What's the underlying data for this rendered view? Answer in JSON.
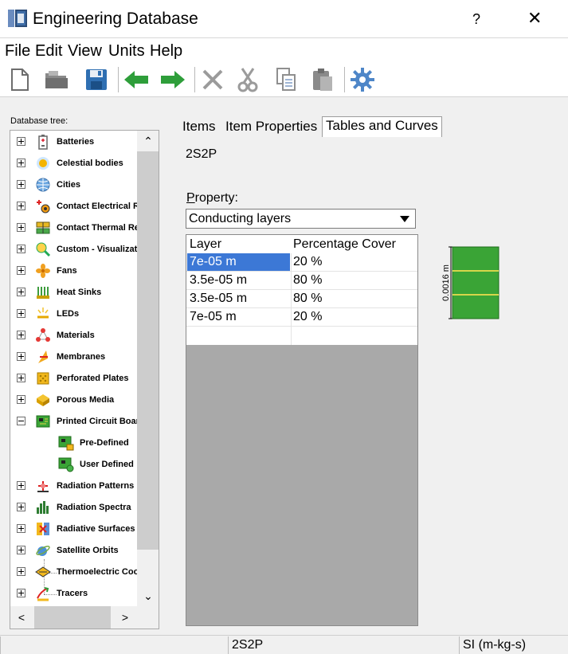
{
  "window": {
    "title": "Engineering Database",
    "help_glyph": "?",
    "close_glyph": "✕"
  },
  "menu": [
    "File",
    "Edit",
    "View",
    "Units",
    "Help"
  ],
  "toolbar": {
    "icons": [
      "new-file-icon",
      "open-folder-icon",
      "save-icon",
      "back-arrow-icon",
      "forward-arrow-icon",
      "delete-icon",
      "cut-icon",
      "copy-icon",
      "paste-icon",
      "settings-gear-icon"
    ]
  },
  "tree": {
    "label": "Database tree:",
    "items": [
      {
        "label": "Batteries",
        "icon": "battery-icon"
      },
      {
        "label": "Celestial bodies",
        "icon": "sun-icon"
      },
      {
        "label": "Cities",
        "icon": "globe-icon"
      },
      {
        "label": "Contact Electrical R",
        "icon": "contact-electrical-icon"
      },
      {
        "label": "Contact Thermal Re",
        "icon": "contact-thermal-icon"
      },
      {
        "label": "Custom - Visualizati",
        "icon": "magnifier-icon"
      },
      {
        "label": "Fans",
        "icon": "fan-icon"
      },
      {
        "label": "Heat Sinks",
        "icon": "heat-sink-icon"
      },
      {
        "label": "LEDs",
        "icon": "led-icon"
      },
      {
        "label": "Materials",
        "icon": "materials-icon"
      },
      {
        "label": "Membranes",
        "icon": "membrane-icon"
      },
      {
        "label": "Perforated Plates",
        "icon": "perforated-plate-icon"
      },
      {
        "label": "Porous Media",
        "icon": "porous-media-icon"
      },
      {
        "label": "Printed Circuit Boar",
        "icon": "pcb-icon",
        "expanded": true
      },
      {
        "label": "Radiation Patterns",
        "icon": "radiation-pattern-icon"
      },
      {
        "label": "Radiation Spectra",
        "icon": "radiation-spectra-icon"
      },
      {
        "label": "Radiative Surfaces",
        "icon": "radiative-surface-icon"
      },
      {
        "label": "Satellite Orbits",
        "icon": "satellite-icon"
      },
      {
        "label": "Thermoelectric Coo",
        "icon": "thermoelectric-icon"
      },
      {
        "label": "Tracers",
        "icon": "tracer-icon"
      }
    ],
    "children": [
      {
        "label": "Pre-Defined",
        "icon": "pcb-locked-icon"
      },
      {
        "label": "User Defined",
        "icon": "pcb-user-icon"
      }
    ],
    "scroll_up": "⌃",
    "scroll_down": "⌄",
    "scroll_left": "<",
    "scroll_right": ">"
  },
  "tabs": [
    {
      "label": "Items",
      "active": false
    },
    {
      "label": "Item Properties",
      "active": false
    },
    {
      "label": "Tables and Curves",
      "active": true
    }
  ],
  "item_name": "2S2P",
  "property": {
    "label_prefix": "P",
    "label_rest": "roperty:",
    "selected": "Conducting layers"
  },
  "table": {
    "headers": [
      "Layer",
      "Percentage Cover"
    ],
    "rows": [
      {
        "layer": "7e-05 m",
        "cover": "20 %"
      },
      {
        "layer": "3.5e-05 m",
        "cover": "80 %"
      },
      {
        "layer": "3.5e-05 m",
        "cover": "80 %"
      },
      {
        "layer": "7e-05 m",
        "cover": "20 %"
      }
    ],
    "selected_row": 0
  },
  "preview": {
    "dimension_label": "0.0016 m",
    "board_color": "#3aa436",
    "layer_line_color": "#d6d64a"
  },
  "status": {
    "item": "2S2P",
    "units": "SI (m-kg-s)"
  }
}
